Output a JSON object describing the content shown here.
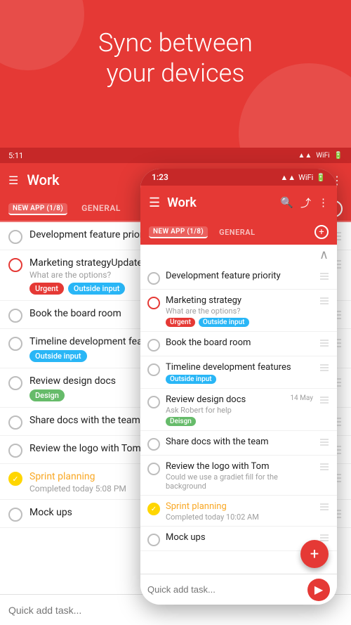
{
  "hero": {
    "title_line1": "Sync between",
    "title_line2": "your devices"
  },
  "app": {
    "title": "Work",
    "status_bar_time_tablet": "5:11",
    "status_bar_time_phone": "1:23",
    "tab_new_app": "NEW APP (1/8)",
    "tab_general": "GENERAL"
  },
  "tasks": [
    {
      "id": "t1",
      "title": "Development feature priority",
      "subtitle": "",
      "tags": [],
      "date": "",
      "completed": false,
      "urgent": false
    },
    {
      "id": "t2",
      "title": "Marketing strategy",
      "subtitle": "What are the options?",
      "tags": [
        "Urgent",
        "Outside input"
      ],
      "date": "",
      "completed": false,
      "urgent": true
    },
    {
      "id": "t3",
      "title": "Book the board room",
      "subtitle": "",
      "tags": [],
      "date": "",
      "completed": false,
      "urgent": false
    },
    {
      "id": "t4",
      "title": "Timeline development features",
      "subtitle": "",
      "tags": [
        "Outside input"
      ],
      "date": "",
      "completed": false,
      "urgent": false
    },
    {
      "id": "t5",
      "title": "Review design docs",
      "subtitle": "Ask Robert for help",
      "tags": [
        "Design"
      ],
      "date": "14 May",
      "completed": false,
      "urgent": false
    },
    {
      "id": "t6",
      "title": "Share docs with the team",
      "subtitle": "",
      "tags": [],
      "date": "",
      "completed": false,
      "urgent": false
    },
    {
      "id": "t7",
      "title": "Review the logo with Tom",
      "subtitle": "Could we use a gradiet fill for the background",
      "tags": [],
      "date": "",
      "completed": false,
      "urgent": false
    },
    {
      "id": "t8",
      "title": "Sprint planning",
      "subtitle": "Completed today 10:02 AM",
      "tags": [],
      "date": "",
      "completed": true,
      "urgent": false
    },
    {
      "id": "t9",
      "title": "Mock ups",
      "subtitle": "",
      "tags": [],
      "date": "",
      "completed": false,
      "urgent": false
    }
  ],
  "quick_add": {
    "placeholder": "Quick add task..."
  },
  "tablet_tasks": [
    {
      "id": "tt1",
      "title": "Development feature priority",
      "subtitle": "",
      "tags": [],
      "date": "",
      "completed": false,
      "urgent": false
    },
    {
      "id": "tt2",
      "title": "Marketing strategyUpdate CV",
      "subtitle": "What are the options?",
      "tags": [
        "Urgent",
        "Outside input"
      ],
      "date": "",
      "completed": false,
      "urgent": true
    },
    {
      "id": "tt3",
      "title": "Book the board room",
      "subtitle": "",
      "tags": [],
      "date": "",
      "completed": false,
      "urgent": false
    },
    {
      "id": "tt4",
      "title": "Timeline development features",
      "subtitle": "",
      "tags": [
        "Outside input"
      ],
      "date": "",
      "completed": false,
      "urgent": false
    },
    {
      "id": "tt5",
      "title": "Review design docs",
      "subtitle": "",
      "tags": [
        "Design"
      ],
      "date": "",
      "completed": false,
      "urgent": false
    },
    {
      "id": "tt6",
      "title": "Share docs with the team",
      "subtitle": "",
      "tags": [],
      "date": "",
      "completed": false,
      "urgent": false
    },
    {
      "id": "tt7",
      "title": "Review the logo with Tom",
      "subtitle": "",
      "tags": [],
      "date": "",
      "completed": false,
      "urgent": false
    },
    {
      "id": "tt8",
      "title": "Sprint planning",
      "subtitle": "Completed today 5:08 PM",
      "tags": [],
      "date": "",
      "completed": true,
      "urgent": false
    },
    {
      "id": "tt9",
      "title": "Mock ups",
      "subtitle": "",
      "tags": [],
      "date": "",
      "completed": false,
      "urgent": false
    }
  ],
  "labels": {
    "urgent": "Urgent",
    "outside_input": "Outside input",
    "design": "Deisgn",
    "fab_plus": "+",
    "send": "▶",
    "hamburger": "☰",
    "search": "🔍",
    "share": "⤴",
    "more": "⋮",
    "chevron_up": "∧",
    "chevron_down": "∨"
  }
}
